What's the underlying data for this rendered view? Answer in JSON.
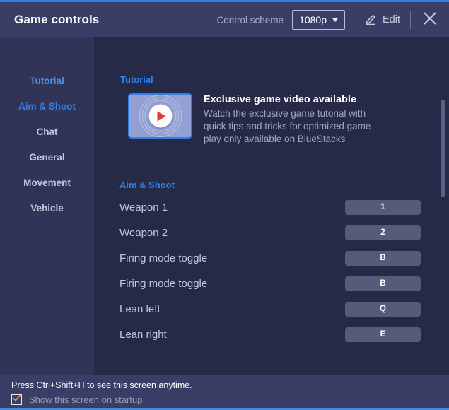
{
  "header": {
    "title": "Game controls",
    "scheme_label": "Control scheme",
    "scheme_value": "1080p",
    "edit_label": "Edit",
    "close_icon": "close-icon",
    "edit_icon": "pencil-icon",
    "caret_icon": "chevron-down-icon"
  },
  "sidebar": {
    "items": [
      {
        "label": "Tutorial",
        "state": "sel-soft"
      },
      {
        "label": "Aim & Shoot",
        "state": "sel-strong"
      },
      {
        "label": "Chat",
        "state": ""
      },
      {
        "label": "General",
        "state": ""
      },
      {
        "label": "Movement",
        "state": ""
      },
      {
        "label": "Vehicle",
        "state": ""
      }
    ]
  },
  "tutorial": {
    "section_title": "Tutorial",
    "video_title": "Exclusive game video available",
    "video_desc": "Watch the exclusive game tutorial with quick tips and tricks for optimized game play only available on BlueStacks",
    "play_icon": "play-icon"
  },
  "aim_shoot": {
    "section_title": "Aim & Shoot",
    "rows": [
      {
        "label": "Weapon 1",
        "key": "1"
      },
      {
        "label": "Weapon 2",
        "key": "2"
      },
      {
        "label": "Firing mode toggle",
        "key": "B"
      },
      {
        "label": "Firing mode toggle",
        "key": "B"
      },
      {
        "label": "Lean left",
        "key": "Q"
      },
      {
        "label": "Lean right",
        "key": "E"
      }
    ]
  },
  "footer": {
    "hint": "Press Ctrl+Shift+H to see this screen anytime.",
    "checkbox_label": "Show this screen on startup",
    "checkbox_checked": true,
    "check_icon": "check-icon"
  },
  "colors": {
    "accent": "#2f7fe8",
    "header_bg": "#3a3d66",
    "sidebar_bg": "#313457",
    "main_bg": "#272a47",
    "key_chip": "#575b7a",
    "check_orange": "#e8962c",
    "play_red": "#e23b35"
  }
}
